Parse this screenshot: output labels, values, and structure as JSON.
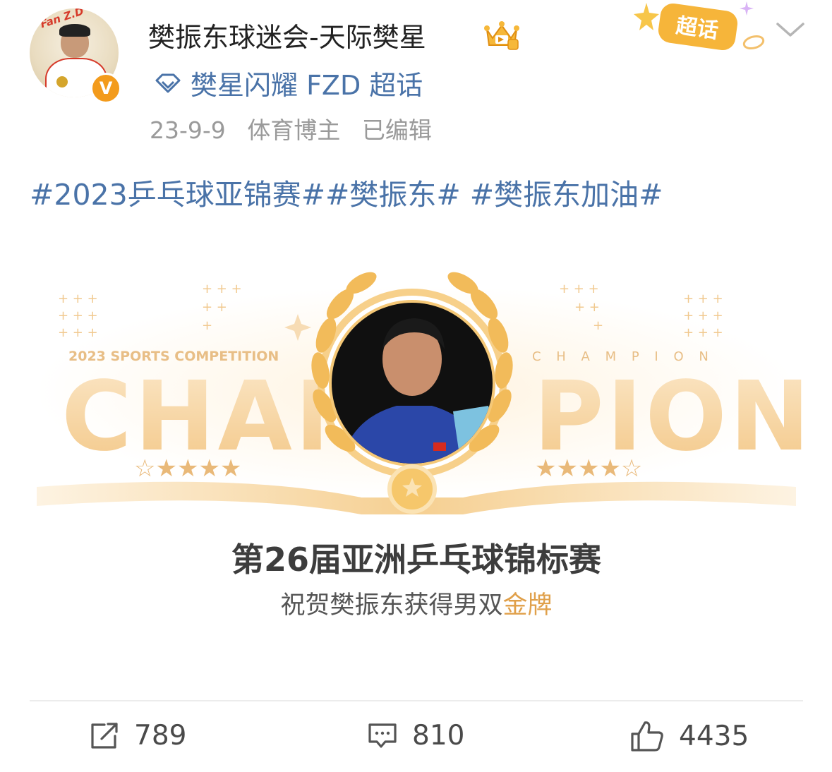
{
  "header": {
    "username": "樊振东球迷会-天际樊星",
    "avatar_text": "Fan Z.D",
    "verified_mark": "V",
    "supertopic_badge": "超话",
    "topic_link": "樊星闪耀 FZD 超话",
    "meta": {
      "date": "23-9-9",
      "role": "体育博主",
      "edited": "已编辑"
    }
  },
  "post": {
    "hashtags": "#2023乒乓球亚锦赛##樊振东# #樊振东加油#",
    "image": {
      "small_caption": "2023 SPORTS COMPETITION",
      "champion_spaced": "C H A M P I O N",
      "big_left": "CHAM",
      "big_right": "PION",
      "title": "第26届亚洲乒乓球锦标赛",
      "subtitle_prefix": "祝贺樊振东获得男双",
      "subtitle_highlight": "金牌"
    }
  },
  "actions": {
    "reposts": "789",
    "comments": "810",
    "likes": "4435"
  },
  "colors": {
    "link": "#4a73a8",
    "gold": "#e0a04a",
    "verify": "#f39b1c"
  }
}
